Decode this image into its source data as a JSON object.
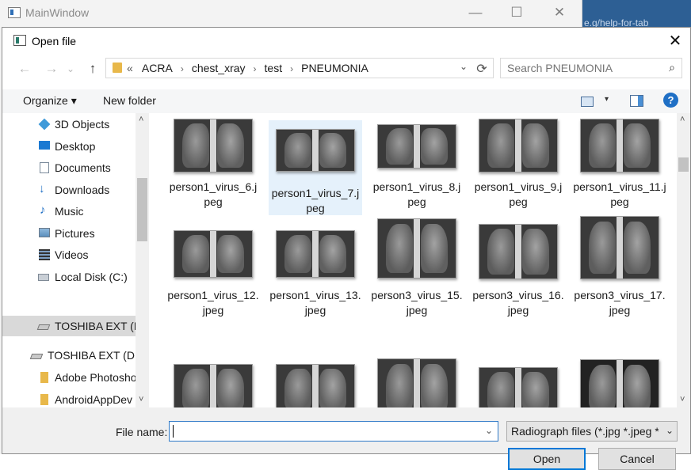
{
  "main_window": {
    "title": "MainWindow",
    "minimize": "—",
    "maximize": "☐",
    "close": "✕",
    "background_snippet": "e.g/help-for-tab"
  },
  "dialog": {
    "title": "Open file",
    "close": "✕"
  },
  "nav": {
    "back": "←",
    "forward": "→",
    "recent": "⌄",
    "up": "↑",
    "overflow": "«",
    "breadcrumbs": [
      "ACRA",
      "chest_xray",
      "test",
      "PNEUMONIA"
    ],
    "separator": "›",
    "dropdown": "⌄",
    "refresh": "⟳"
  },
  "search": {
    "placeholder": "Search PNEUMONIA",
    "icon": "search-icon"
  },
  "toolbar": {
    "organize": "Organize ▾",
    "new_folder": "New folder",
    "view_dropdown": "▾",
    "help": "?"
  },
  "sidebar": {
    "items": [
      {
        "label": "3D Objects",
        "icon": "3d-objects-icon"
      },
      {
        "label": "Desktop",
        "icon": "desktop-icon"
      },
      {
        "label": "Documents",
        "icon": "documents-icon"
      },
      {
        "label": "Downloads",
        "icon": "downloads-icon"
      },
      {
        "label": "Music",
        "icon": "music-icon"
      },
      {
        "label": "Pictures",
        "icon": "pictures-icon"
      },
      {
        "label": "Videos",
        "icon": "videos-icon"
      },
      {
        "label": "Local Disk (C:)",
        "icon": "local-disk-icon"
      },
      {
        "label": "TOSHIBA EXT (D:)",
        "icon": "drive-icon",
        "selected": true
      },
      {
        "label": "TOSHIBA EXT (D:)",
        "icon": "drive-icon"
      },
      {
        "label": "Adobe Photoshop",
        "icon": "folder-icon"
      },
      {
        "label": "AndroidAppDev",
        "icon": "folder-icon"
      }
    ]
  },
  "files": [
    {
      "name": "person1_virus_6.jpeg"
    },
    {
      "name": "person1_virus_7.jpeg",
      "selected": true
    },
    {
      "name": "person1_virus_8.jpeg"
    },
    {
      "name": "person1_virus_9.jpeg"
    },
    {
      "name": "person1_virus_11.jpeg"
    },
    {
      "name": "person1_virus_12.jpeg"
    },
    {
      "name": "person1_virus_13.jpeg"
    },
    {
      "name": "person3_virus_15.jpeg"
    },
    {
      "name": "person3_virus_16.jpeg"
    },
    {
      "name": "person3_virus_17.jpeg"
    },
    {
      "name": ""
    },
    {
      "name": ""
    },
    {
      "name": ""
    },
    {
      "name": ""
    },
    {
      "name": ""
    }
  ],
  "bottom": {
    "file_name_label": "File name:",
    "file_name_value": "",
    "file_type": "Radiograph files (*.jpg *.jpeg *.)",
    "open": "Open",
    "cancel": "Cancel"
  },
  "colors": {
    "accent": "#0078d7",
    "selection": "#e5f1fb",
    "folder": "#e8b84a"
  }
}
